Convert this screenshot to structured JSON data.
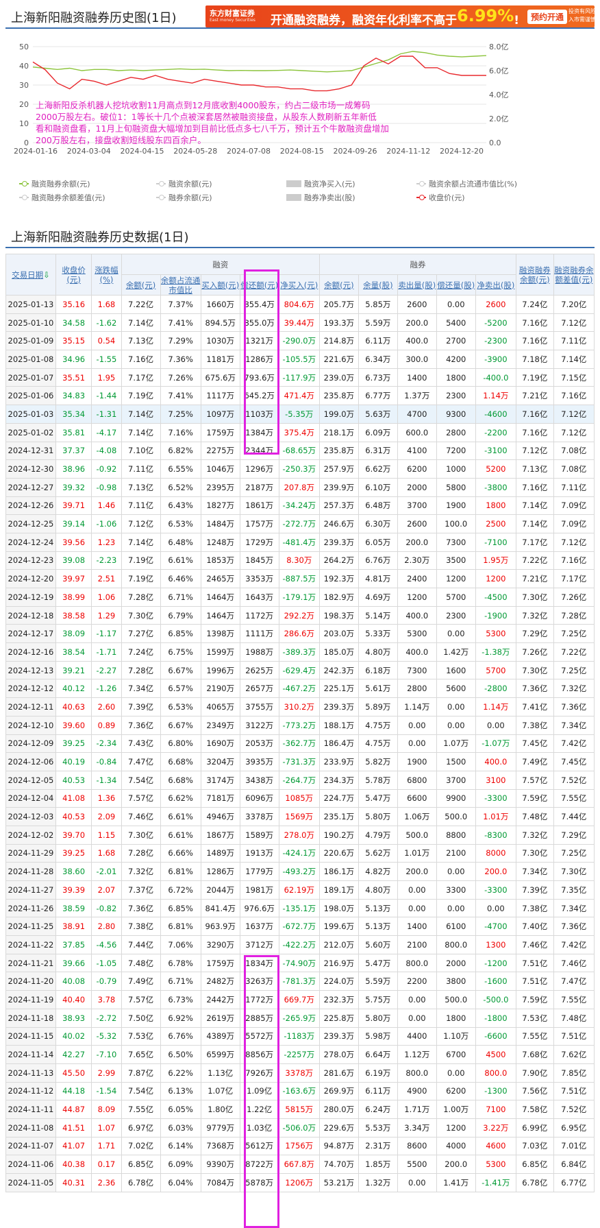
{
  "chart_section": {
    "title": "上海新阳融资融券历史图(1日)"
  },
  "ad": {
    "brand": "东方财富证券",
    "brand_sub": "East money Securities",
    "text_before": "开通融资融券，融资年化利率不高于",
    "rate": "6.99%",
    "excl": "!",
    "button": "预约开通",
    "risk_line1": "投资有风险",
    "risk_line2": "入市需谨慎"
  },
  "chart_data": {
    "type": "line",
    "x_tick_labels": [
      "2024-01-16",
      "2024-03-04",
      "2024-04-15",
      "2024-05-28",
      "2024-07-08",
      "2024-08-15",
      "2024-09-26",
      "2024-11-12",
      "2024-12-20"
    ],
    "y_left_ticks": [
      "50",
      "40",
      "30",
      "20",
      "10",
      "0"
    ],
    "y_left_range": [
      0,
      50
    ],
    "y_right_ticks": [
      "8.0亿",
      "6.0亿",
      "4.0亿",
      "2.0亿",
      "0.0"
    ],
    "y_right_range": [
      0,
      8
    ],
    "annotation": "上海新阳反杀机器人挖坑收割11月高点到12月底收割4000股东，约占二级市场一成筹码2000万股左右。破位1：1等长十几个点被深套居然被融资接盘，从股东人数刷新五年新低看和融资盘看，11月上旬融资盘大幅增加到目前比低点多七八千万，预计五个牛散融资盘增加200万股左右，接盘收割短线股东四百余户。",
    "series": [
      {
        "name": "融资融券余额(元)",
        "axis": "right",
        "color": "#8cc43c",
        "values": [
          6.3,
          6.2,
          6.1,
          6.2,
          6.0,
          6.1,
          6.1,
          6.0,
          6.05,
          6.0,
          6.05,
          6.1,
          6.15,
          6.1,
          6.12,
          6.05,
          6.0,
          6.02,
          6.0,
          6.0,
          6.02,
          6.05,
          6.0,
          5.95,
          5.9,
          5.95,
          6.0,
          6.3,
          6.6,
          6.9,
          7.4,
          7.6,
          7.5,
          7.3,
          7.2,
          7.15,
          7.2,
          7.25
        ]
      },
      {
        "name": "收盘价(元)",
        "axis": "left",
        "color": "#e8282d",
        "values": [
          42,
          38,
          31,
          28,
          33,
          32,
          30,
          32,
          34,
          33,
          35,
          33,
          32,
          31,
          33,
          32,
          31,
          30,
          30,
          29,
          29,
          28,
          28,
          27,
          27,
          28,
          30,
          40,
          44,
          41,
          45,
          45,
          39,
          39,
          36,
          35,
          35,
          35
        ]
      }
    ],
    "grid": true
  },
  "legend": [
    {
      "label": "融资融券余额(元)",
      "active": true,
      "kind": "line",
      "color": "#8cc43c"
    },
    {
      "label": "融资余额(元)",
      "active": false,
      "kind": "line",
      "color": "#ccc"
    },
    {
      "label": "融资净买入(元)",
      "active": false,
      "kind": "box",
      "color": "#ccc"
    },
    {
      "label": "融资余额占流通市值比(%)",
      "active": false,
      "kind": "line",
      "color": "#ccc"
    },
    {
      "label": "融资融券余额差值(元)",
      "active": false,
      "kind": "line",
      "color": "#ccc"
    },
    {
      "label": "融券余额(元)",
      "active": false,
      "kind": "line",
      "color": "#ccc"
    },
    {
      "label": "融券净卖出(股)",
      "active": false,
      "kind": "box",
      "color": "#ccc"
    },
    {
      "label": "收盘价(元)",
      "active": true,
      "kind": "line",
      "color": "#e8282d"
    }
  ],
  "table_section": {
    "title": "上海新阳融资融券历史数据(1日)"
  },
  "table": {
    "group_rz": "融资",
    "group_rq": "融券",
    "h_date": "交易日期",
    "h_sort": "⇩",
    "h_close": "收盘价(元)",
    "h_chg": "涨跌幅(%)",
    "h_rz": [
      "余额(元)",
      "余额占流通市值比",
      "买入额(元)",
      "偿还额(元)",
      "净买入(元)"
    ],
    "h_rq": [
      "余额(元)",
      "余量(股)",
      "卖出量(股)",
      "偿还量(股)",
      "净卖出(股)"
    ],
    "h_total": "融资融券余额(元)",
    "h_diff": "融资融券余额差值(元)",
    "rows": [
      [
        "2025-01-13",
        "35.16",
        "1.68",
        "7.22亿",
        "7.37%",
        "1660万",
        "855.4万",
        "804.6万",
        "205.7万",
        "5.85万",
        "2600",
        "0.00",
        "2600",
        "7.24亿",
        "7.20亿"
      ],
      [
        "2025-01-10",
        "34.58",
        "-1.62",
        "7.14亿",
        "7.41%",
        "894.5万",
        "855.0万",
        "39.44万",
        "193.3万",
        "5.59万",
        "200.0",
        "5400",
        "-5200",
        "7.16亿",
        "7.12亿"
      ],
      [
        "2025-01-09",
        "35.15",
        "0.54",
        "7.13亿",
        "7.29%",
        "1030万",
        "1321万",
        "-290.0万",
        "214.8万",
        "6.11万",
        "400.0",
        "2700",
        "-2300",
        "7.16亿",
        "7.11亿"
      ],
      [
        "2025-01-08",
        "34.96",
        "-1.55",
        "7.16亿",
        "7.36%",
        "1181万",
        "1286万",
        "-105.5万",
        "221.6万",
        "6.34万",
        "300.0",
        "4200",
        "-3900",
        "7.18亿",
        "7.14亿"
      ],
      [
        "2025-01-07",
        "35.51",
        "1.95",
        "7.17亿",
        "7.26%",
        "675.6万",
        "793.6万",
        "-117.9万",
        "239.0万",
        "6.73万",
        "1400",
        "1800",
        "-400.0",
        "7.19亿",
        "7.15亿"
      ],
      [
        "2025-01-06",
        "34.83",
        "-1.44",
        "7.19亿",
        "7.41%",
        "1117万",
        "645.2万",
        "471.4万",
        "235.8万",
        "6.77万",
        "1.37万",
        "2300",
        "1.14万",
        "7.21亿",
        "7.16亿"
      ],
      [
        "2025-01-03",
        "35.34",
        "-1.31",
        "7.14亿",
        "7.25%",
        "1097万",
        "1103万",
        "-5.35万",
        "199.0万",
        "5.63万",
        "4700",
        "9300",
        "-4600",
        "7.16亿",
        "7.12亿"
      ],
      [
        "2025-01-02",
        "35.81",
        "-4.17",
        "7.14亿",
        "7.16%",
        "1759万",
        "1384万",
        "375.4万",
        "218.1万",
        "6.09万",
        "600.0",
        "2800",
        "-2200",
        "7.16亿",
        "7.12亿"
      ],
      [
        "2024-12-31",
        "37.37",
        "-4.08",
        "7.10亿",
        "6.82%",
        "2275万",
        "2344万",
        "-68.65万",
        "235.8万",
        "6.31万",
        "4100",
        "7200",
        "-3100",
        "7.12亿",
        "7.08亿"
      ],
      [
        "2024-12-30",
        "38.96",
        "-0.92",
        "7.11亿",
        "6.55%",
        "1046万",
        "1296万",
        "-250.3万",
        "257.9万",
        "6.62万",
        "6200",
        "1000",
        "5200",
        "7.13亿",
        "7.08亿"
      ],
      [
        "2024-12-27",
        "39.32",
        "-0.98",
        "7.13亿",
        "6.52%",
        "2395万",
        "2187万",
        "207.8万",
        "239.9万",
        "6.10万",
        "2000",
        "5800",
        "-3800",
        "7.16亿",
        "7.11亿"
      ],
      [
        "2024-12-26",
        "39.71",
        "1.46",
        "7.11亿",
        "6.43%",
        "1827万",
        "1861万",
        "-34.24万",
        "257.3万",
        "6.48万",
        "3700",
        "1900",
        "1800",
        "7.14亿",
        "7.09亿"
      ],
      [
        "2024-12-25",
        "39.14",
        "-1.06",
        "7.12亿",
        "6.53%",
        "1484万",
        "1757万",
        "-272.7万",
        "246.6万",
        "6.30万",
        "2600",
        "100.0",
        "2500",
        "7.14亿",
        "7.09亿"
      ],
      [
        "2024-12-24",
        "39.56",
        "1.23",
        "7.14亿",
        "6.48%",
        "1248万",
        "1729万",
        "-481.4万",
        "239.3万",
        "6.05万",
        "200.0",
        "7300",
        "-7100",
        "7.17亿",
        "7.12亿"
      ],
      [
        "2024-12-23",
        "39.08",
        "-2.23",
        "7.19亿",
        "6.61%",
        "1853万",
        "1845万",
        "8.30万",
        "264.2万",
        "6.76万",
        "2.30万",
        "3500",
        "1.95万",
        "7.22亿",
        "7.16亿"
      ],
      [
        "2024-12-20",
        "39.97",
        "2.51",
        "7.19亿",
        "6.46%",
        "2465万",
        "3353万",
        "-887.5万",
        "192.3万",
        "4.81万",
        "2400",
        "1200",
        "1200",
        "7.21亿",
        "7.17亿"
      ],
      [
        "2024-12-19",
        "38.99",
        "1.06",
        "7.28亿",
        "6.71%",
        "1464万",
        "1643万",
        "-179.1万",
        "182.9万",
        "4.69万",
        "1200",
        "5700",
        "-4500",
        "7.30亿",
        "7.26亿"
      ],
      [
        "2024-12-18",
        "38.58",
        "1.29",
        "7.30亿",
        "6.79%",
        "1464万",
        "1172万",
        "292.2万",
        "198.3万",
        "5.14万",
        "400.0",
        "2300",
        "-1900",
        "7.32亿",
        "7.28亿"
      ],
      [
        "2024-12-17",
        "38.09",
        "-1.17",
        "7.27亿",
        "6.85%",
        "1398万",
        "1111万",
        "286.6万",
        "203.0万",
        "5.33万",
        "5300",
        "0.00",
        "5300",
        "7.29亿",
        "7.25亿"
      ],
      [
        "2024-12-16",
        "38.54",
        "-1.71",
        "7.24亿",
        "6.75%",
        "1599万",
        "1988万",
        "-389.3万",
        "185.0万",
        "4.80万",
        "400.0",
        "1.42万",
        "-1.38万",
        "7.26亿",
        "7.22亿"
      ],
      [
        "2024-12-13",
        "39.21",
        "-2.27",
        "7.28亿",
        "6.67%",
        "1996万",
        "2625万",
        "-629.4万",
        "242.3万",
        "6.18万",
        "7300",
        "1600",
        "5700",
        "7.30亿",
        "7.25亿"
      ],
      [
        "2024-12-12",
        "40.12",
        "-1.26",
        "7.34亿",
        "6.57%",
        "2190万",
        "2657万",
        "-467.2万",
        "225.1万",
        "5.61万",
        "2800",
        "5600",
        "-2800",
        "7.36亿",
        "7.32亿"
      ],
      [
        "2024-12-11",
        "40.63",
        "2.60",
        "7.39亿",
        "6.53%",
        "4065万",
        "3755万",
        "310.2万",
        "239.3万",
        "5.89万",
        "1.14万",
        "0.00",
        "1.14万",
        "7.41亿",
        "7.36亿"
      ],
      [
        "2024-12-10",
        "39.60",
        "0.89",
        "7.36亿",
        "6.67%",
        "2349万",
        "3122万",
        "-773.2万",
        "188.1万",
        "4.75万",
        "0.00",
        "0.00",
        "0.00",
        "7.38亿",
        "7.34亿"
      ],
      [
        "2024-12-09",
        "39.25",
        "-2.34",
        "7.43亿",
        "6.80%",
        "1690万",
        "2053万",
        "-362.7万",
        "186.4万",
        "4.75万",
        "0.00",
        "1.07万",
        "-1.07万",
        "7.45亿",
        "7.42亿"
      ],
      [
        "2024-12-06",
        "40.19",
        "-0.84",
        "7.47亿",
        "6.68%",
        "3204万",
        "3935万",
        "-731.3万",
        "233.9万",
        "5.82万",
        "1900",
        "1500",
        "400.0",
        "7.49亿",
        "7.45亿"
      ],
      [
        "2024-12-05",
        "40.53",
        "-1.34",
        "7.54亿",
        "6.68%",
        "3174万",
        "3438万",
        "-264.7万",
        "234.3万",
        "5.78万",
        "6800",
        "3700",
        "3100",
        "7.57亿",
        "7.52亿"
      ],
      [
        "2024-12-04",
        "41.08",
        "1.36",
        "7.57亿",
        "6.62%",
        "7181万",
        "6096万",
        "1085万",
        "224.7万",
        "5.47万",
        "6600",
        "9900",
        "-3300",
        "7.59亿",
        "7.55亿"
      ],
      [
        "2024-12-03",
        "40.53",
        "2.09",
        "7.46亿",
        "6.61%",
        "4946万",
        "3378万",
        "1569万",
        "235.1万",
        "5.80万",
        "1.06万",
        "500.0",
        "1.01万",
        "7.48亿",
        "7.44亿"
      ],
      [
        "2024-12-02",
        "39.70",
        "1.15",
        "7.30亿",
        "6.61%",
        "1867万",
        "1589万",
        "278.0万",
        "190.2万",
        "4.79万",
        "500.0",
        "8800",
        "-8300",
        "7.32亿",
        "7.29亿"
      ],
      [
        "2024-11-29",
        "39.25",
        "1.68",
        "7.28亿",
        "6.66%",
        "1489万",
        "1913万",
        "-424.1万",
        "220.6万",
        "5.62万",
        "1.01万",
        "2100",
        "8000",
        "7.30亿",
        "7.25亿"
      ],
      [
        "2024-11-28",
        "38.60",
        "-2.01",
        "7.32亿",
        "6.81%",
        "1286万",
        "1779万",
        "-493.2万",
        "186.1万",
        "4.82万",
        "200.0",
        "0.00",
        "200.0",
        "7.34亿",
        "7.30亿"
      ],
      [
        "2024-11-27",
        "39.39",
        "2.07",
        "7.37亿",
        "6.72%",
        "2044万",
        "1981万",
        "62.19万",
        "189.1万",
        "4.80万",
        "0.00",
        "3300",
        "-3300",
        "7.39亿",
        "7.35亿"
      ],
      [
        "2024-11-26",
        "38.59",
        "-0.82",
        "7.36亿",
        "6.85%",
        "841.4万",
        "976.6万",
        "-135.1万",
        "198.0万",
        "5.13万",
        "0.00",
        "0.00",
        "0.00",
        "7.38亿",
        "7.34亿"
      ],
      [
        "2024-11-25",
        "38.91",
        "2.80",
        "7.38亿",
        "6.81%",
        "963.9万",
        "1637万",
        "-672.7万",
        "199.6万",
        "5.13万",
        "1400",
        "6100",
        "-4700",
        "7.40亿",
        "7.36亿"
      ],
      [
        "2024-11-22",
        "37.85",
        "-4.56",
        "7.44亿",
        "7.06%",
        "3290万",
        "3712万",
        "-422.2万",
        "212.0万",
        "5.60万",
        "2100",
        "800.0",
        "1300",
        "7.46亿",
        "7.42亿"
      ],
      [
        "2024-11-21",
        "39.66",
        "-1.05",
        "7.48亿",
        "6.78%",
        "1759万",
        "1834万",
        "-74.90万",
        "216.9万",
        "5.47万",
        "800.0",
        "2000",
        "-1200",
        "7.51亿",
        "7.46亿"
      ],
      [
        "2024-11-20",
        "40.08",
        "-0.79",
        "7.49亿",
        "6.71%",
        "2482万",
        "3263万",
        "-781.3万",
        "224.0万",
        "5.59万",
        "2200",
        "3800",
        "-1600",
        "7.51亿",
        "7.47亿"
      ],
      [
        "2024-11-19",
        "40.40",
        "3.78",
        "7.57亿",
        "6.73%",
        "2442万",
        "1772万",
        "669.7万",
        "232.3万",
        "5.75万",
        "0.00",
        "500.0",
        "-500.0",
        "7.59亿",
        "7.55亿"
      ],
      [
        "2024-11-18",
        "38.93",
        "-2.72",
        "7.50亿",
        "6.92%",
        "2619万",
        "2885万",
        "-265.9万",
        "225.8万",
        "5.80万",
        "0.00",
        "1800",
        "-1800",
        "7.53亿",
        "7.48亿"
      ],
      [
        "2024-11-15",
        "40.02",
        "-5.32",
        "7.53亿",
        "6.76%",
        "4389万",
        "5572万",
        "-1183万",
        "239.3万",
        "5.98万",
        "4400",
        "1.10万",
        "-6600",
        "7.55亿",
        "7.51亿"
      ],
      [
        "2024-11-14",
        "42.27",
        "-7.10",
        "7.65亿",
        "6.50%",
        "6599万",
        "8856万",
        "-2257万",
        "278.0万",
        "6.64万",
        "1.12万",
        "6700",
        "4500",
        "7.68亿",
        "7.62亿"
      ],
      [
        "2024-11-13",
        "45.50",
        "2.99",
        "7.87亿",
        "6.22%",
        "1.13亿",
        "7926万",
        "3378万",
        "281.6万",
        "6.19万",
        "800.0",
        "0.00",
        "800.0",
        "7.90亿",
        "7.85亿"
      ],
      [
        "2024-11-12",
        "44.18",
        "-1.54",
        "7.54亿",
        "6.13%",
        "1.07亿",
        "1.09亿",
        "-163.6万",
        "269.9万",
        "6.11万",
        "4900",
        "6200",
        "-1300",
        "7.56亿",
        "7.51亿"
      ],
      [
        "2024-11-11",
        "44.87",
        "8.09",
        "7.55亿",
        "6.05%",
        "1.80亿",
        "1.22亿",
        "5815万",
        "280.0万",
        "6.24万",
        "1.71万",
        "1.00万",
        "7100",
        "7.58亿",
        "7.52亿"
      ],
      [
        "2024-11-08",
        "41.51",
        "1.07",
        "6.97亿",
        "6.03%",
        "9779万",
        "1.03亿",
        "-506.0万",
        "229.6万",
        "5.53万",
        "3.34万",
        "1200",
        "3.22万",
        "6.99亿",
        "6.95亿"
      ],
      [
        "2024-11-07",
        "41.07",
        "1.71",
        "7.02亿",
        "6.14%",
        "7368万",
        "5612万",
        "1756万",
        "94.87万",
        "2.31万",
        "8600",
        "4000",
        "4600",
        "7.03亿",
        "7.01亿"
      ],
      [
        "2024-11-06",
        "40.38",
        "0.17",
        "6.85亿",
        "6.09%",
        "9390万",
        "8722万",
        "667.8万",
        "74.70万",
        "1.85万",
        "5500",
        "200.0",
        "5300",
        "6.85亿",
        "6.84亿"
      ],
      [
        "2024-11-05",
        "40.31",
        "2.36",
        "6.78亿",
        "6.04%",
        "7084万",
        "5878万",
        "1206万",
        "53.21万",
        "1.32万",
        "0.00",
        "1.41万",
        "-1.41万",
        "6.78亿",
        "6.77亿"
      ]
    ]
  }
}
